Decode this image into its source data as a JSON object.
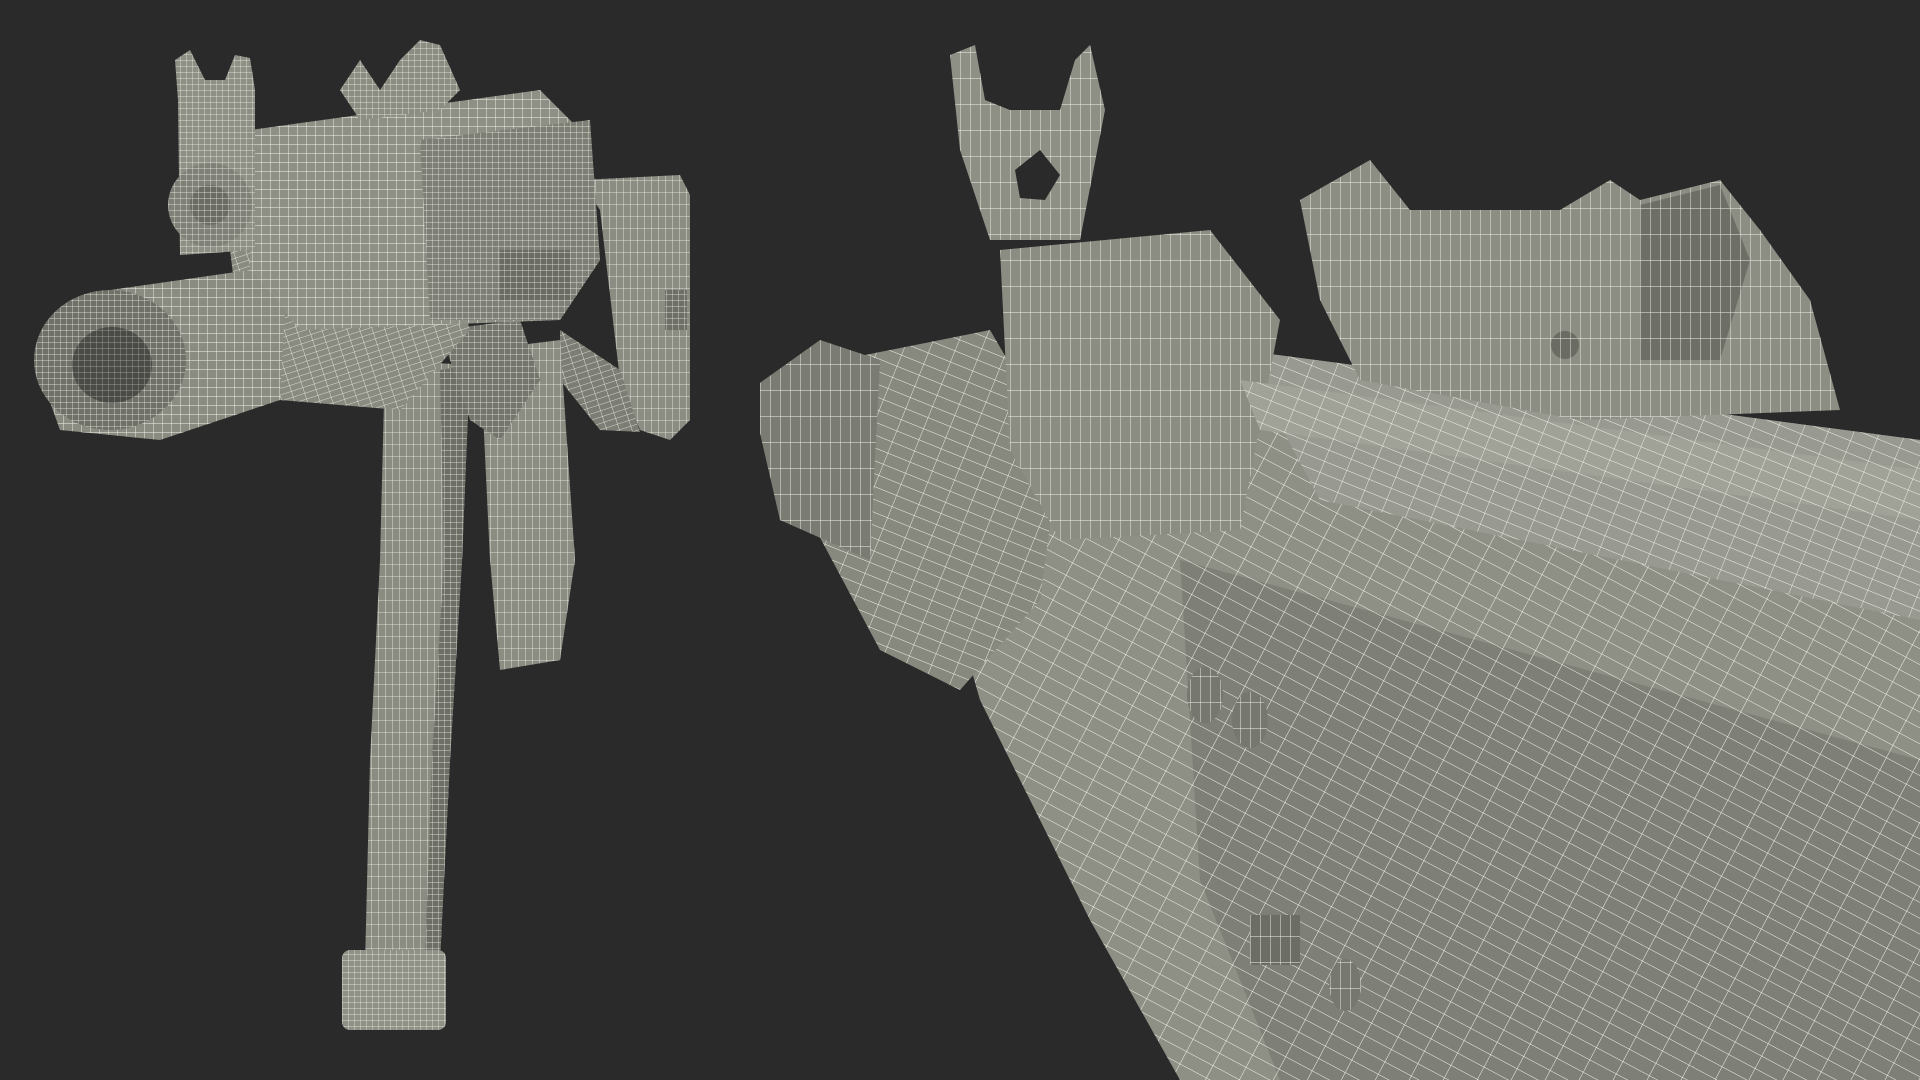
{
  "scene": {
    "background_color": "#2a2a2a",
    "mesh_fill_color": "#8e8f85",
    "mesh_shadow_color": "#5f605a",
    "wire_color": "#f3f3ea",
    "description_none": ""
  },
  "views": [
    {
      "id": "overview",
      "subject": "compact-rifle-wireframe-front-three-quarter"
    },
    {
      "id": "closeup",
      "subject": "rifle-receiver-and-sights-wireframe-closeup"
    }
  ]
}
